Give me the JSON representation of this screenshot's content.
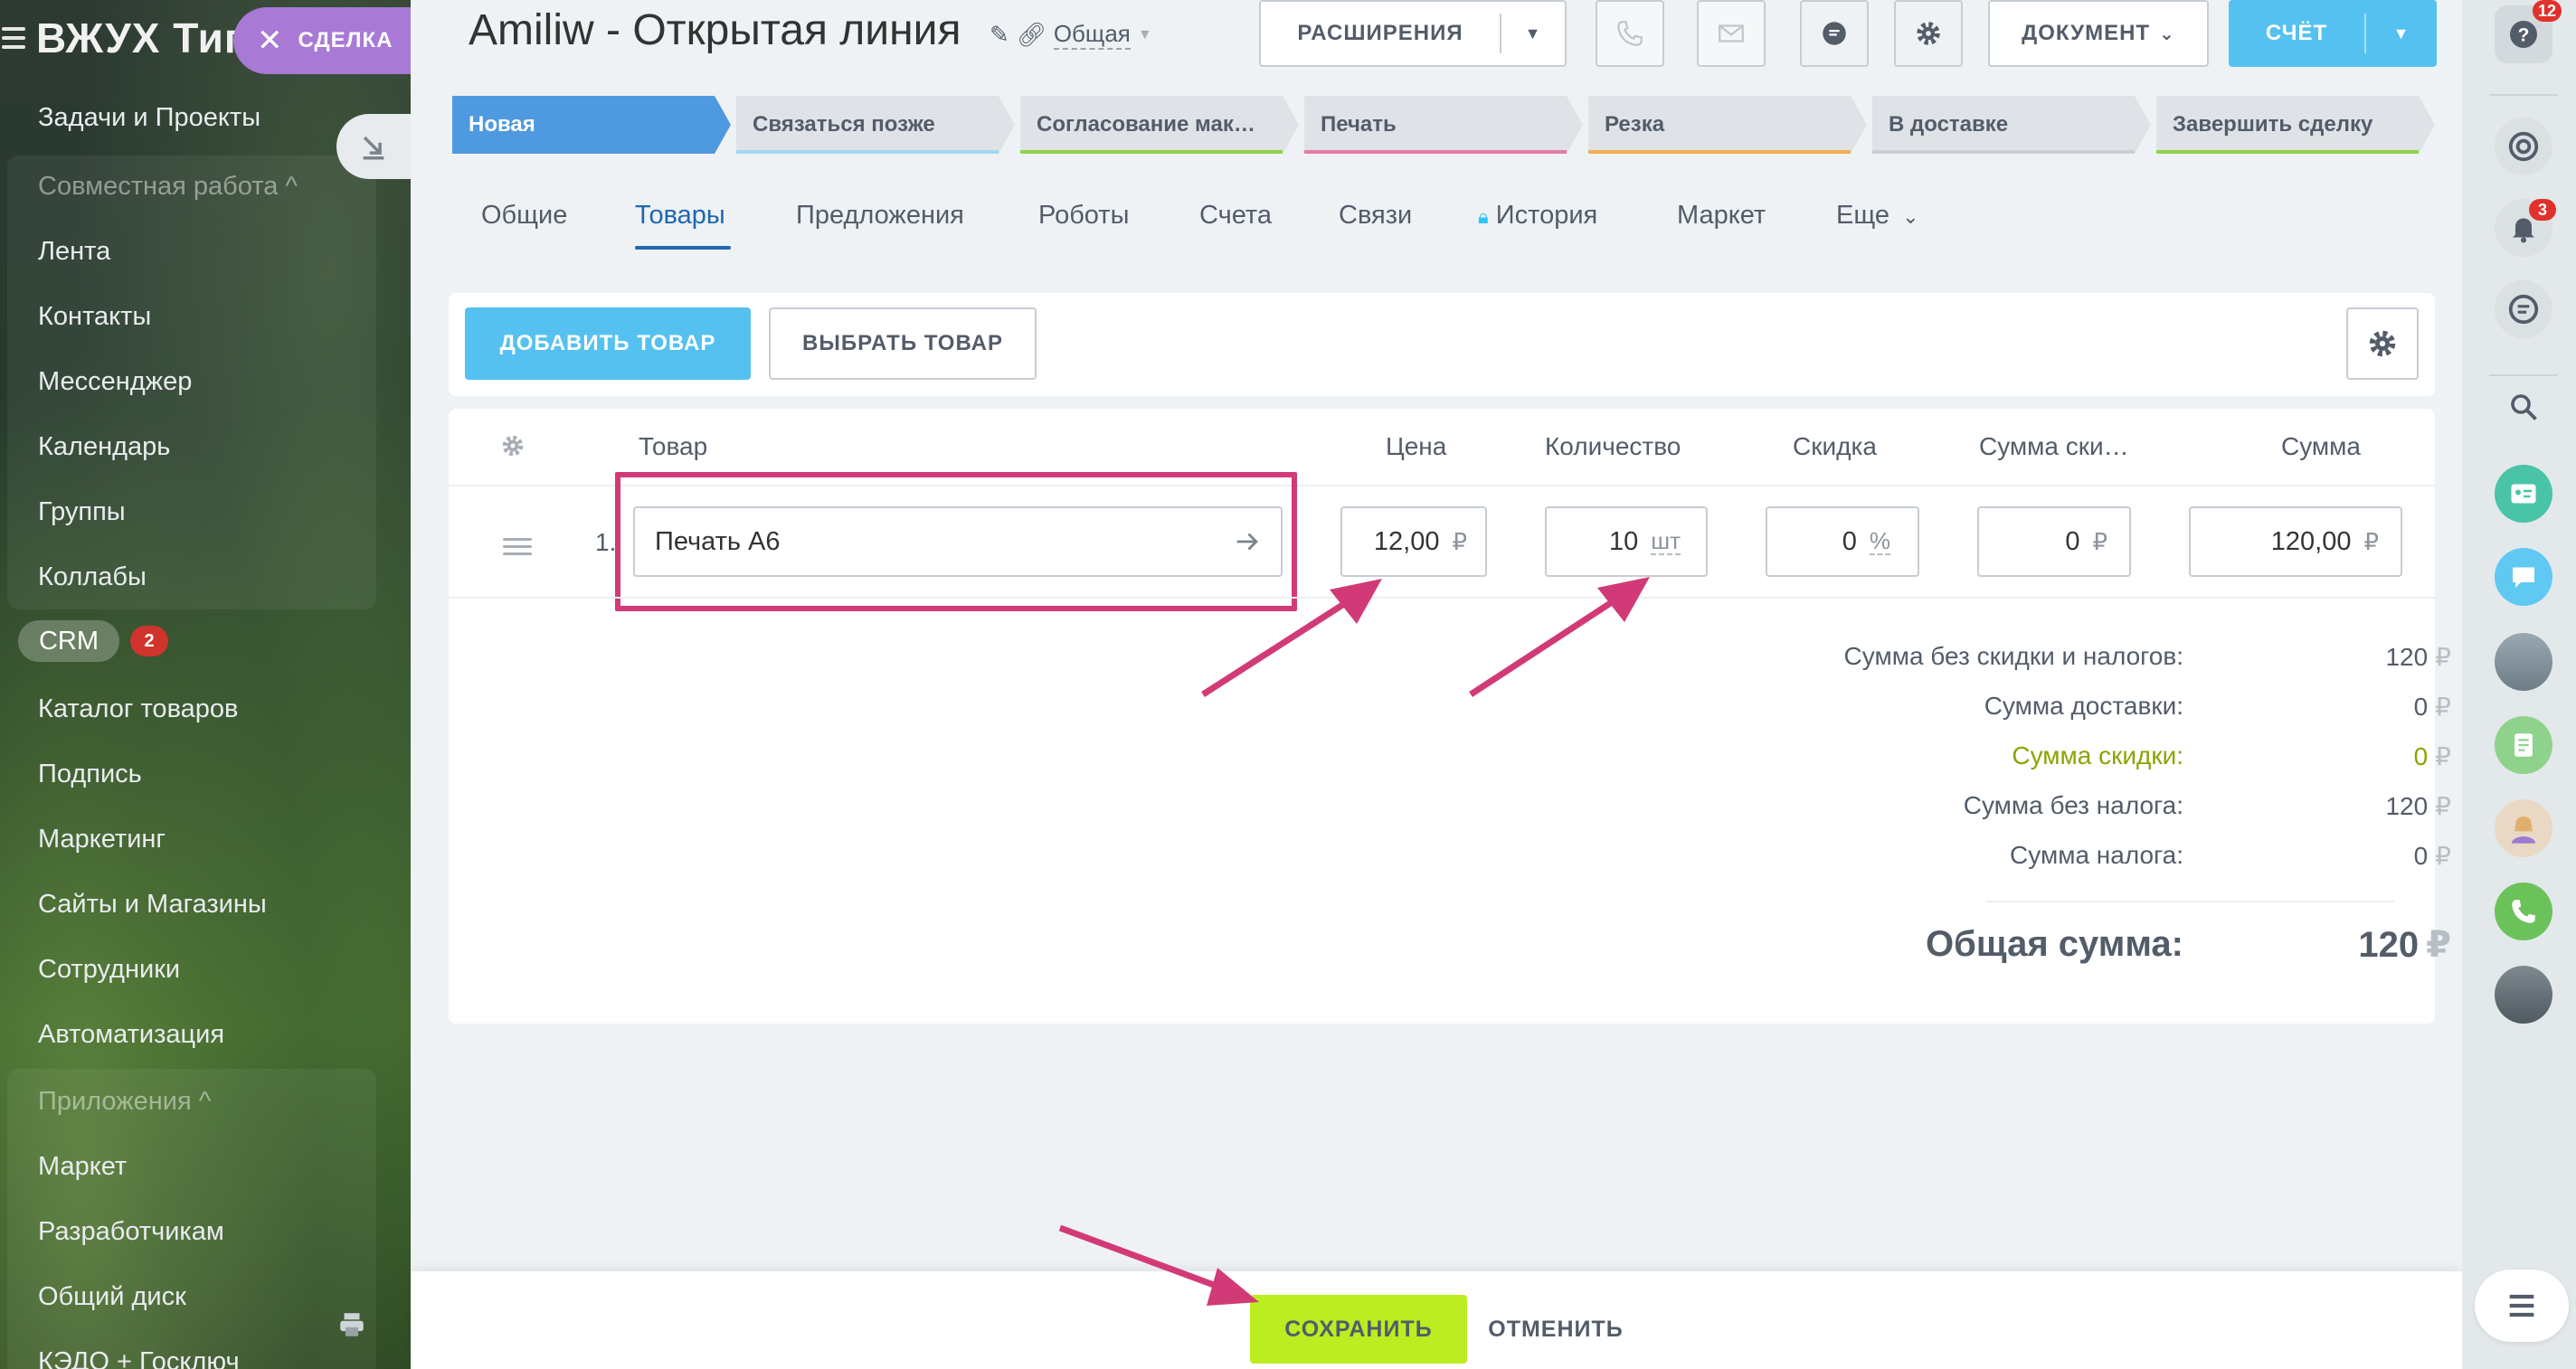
{
  "sidebar": {
    "brand": "ВЖУХ Тип",
    "items": [
      {
        "label": "Задачи и Проекты"
      },
      {
        "label": "Совместная работа ^"
      },
      {
        "label": "Лента"
      },
      {
        "label": "Контакты"
      },
      {
        "label": "Мессенджер"
      },
      {
        "label": "Календарь"
      },
      {
        "label": "Группы"
      },
      {
        "label": "Коллабы"
      },
      {
        "label": "Каталог товаров"
      },
      {
        "label": "Подпись"
      },
      {
        "label": "Маркетинг"
      },
      {
        "label": "Сайты и Магазины"
      },
      {
        "label": "Сотрудники"
      },
      {
        "label": "Автоматизация"
      },
      {
        "label": "Приложения ^"
      },
      {
        "label": "Маркет"
      },
      {
        "label": "Разработчикам"
      },
      {
        "label": "Общий диск"
      },
      {
        "label": "КЭДО + Госключ"
      }
    ],
    "crm_label": "CRM",
    "crm_count": "2"
  },
  "deal_pill": {
    "label": "СДЕЛКА"
  },
  "header": {
    "title": "Amiliw - Открытая линия",
    "category": "Общая",
    "extensions_label": "РАСШИРЕНИЯ",
    "document_label": "ДОКУМЕНТ",
    "invoice_label": "СЧЁТ"
  },
  "stages": [
    {
      "label": "Новая",
      "color": "#4f99e0"
    },
    {
      "label": "Связаться позже",
      "color": "#9fd8f1"
    },
    {
      "label": "Согласование мак…",
      "color": "#8fd24a"
    },
    {
      "label": "Печать",
      "color": "#e77ba9"
    },
    {
      "label": "Резка",
      "color": "#f3b04f"
    },
    {
      "label": "В доставке",
      "color": "#c9cfd5"
    },
    {
      "label": "Завершить сделку",
      "color": "#8fd24a"
    }
  ],
  "tabs": [
    {
      "label": "Общие"
    },
    {
      "label": "Товары"
    },
    {
      "label": "Предложения"
    },
    {
      "label": "Роботы"
    },
    {
      "label": "Счета"
    },
    {
      "label": "Связи"
    },
    {
      "label": "История"
    },
    {
      "label": "Маркет"
    },
    {
      "label": "Еще"
    }
  ],
  "products": {
    "add_label": "ДОБАВИТЬ ТОВАР",
    "pick_label": "ВЫБРАТЬ ТОВАР",
    "columns": {
      "product": "Товар",
      "price": "Цена",
      "quantity": "Количество",
      "discount": "Скидка",
      "discount_sum": "Сумма ски…",
      "sum": "Сумма"
    },
    "rows": [
      {
        "num": "1.",
        "name": "Печать А6",
        "price": "12,00",
        "price_currency": "₽",
        "quantity": "10",
        "unit": "шт",
        "discount": "0",
        "discount_unit": "%",
        "discount_sum": "0",
        "discount_sum_currency": "₽",
        "sum": "120,00",
        "sum_currency": "₽"
      }
    ]
  },
  "totals": {
    "currency": "₽",
    "lines": [
      {
        "label": "Сумма без скидки и налогов:",
        "value": "120"
      },
      {
        "label": "Сумма доставки:",
        "value": "0"
      },
      {
        "label": "Сумма скидки:",
        "value": "0"
      },
      {
        "label": "Сумма без налога:",
        "value": "120"
      },
      {
        "label": "Сумма налога:",
        "value": "0"
      }
    ],
    "total_label": "Общая сумма:",
    "total_value": "120"
  },
  "footer": {
    "save_label": "СОХРАНИТЬ",
    "cancel_label": "ОТМЕНИТЬ"
  },
  "rail": {
    "help_badge": "12",
    "notifications_badge": "3"
  },
  "colors": {
    "accent_blue": "#55c1f0",
    "highlight_pink": "#d23a77",
    "save_green": "#bbed21",
    "active_tab": "#2067b0"
  }
}
